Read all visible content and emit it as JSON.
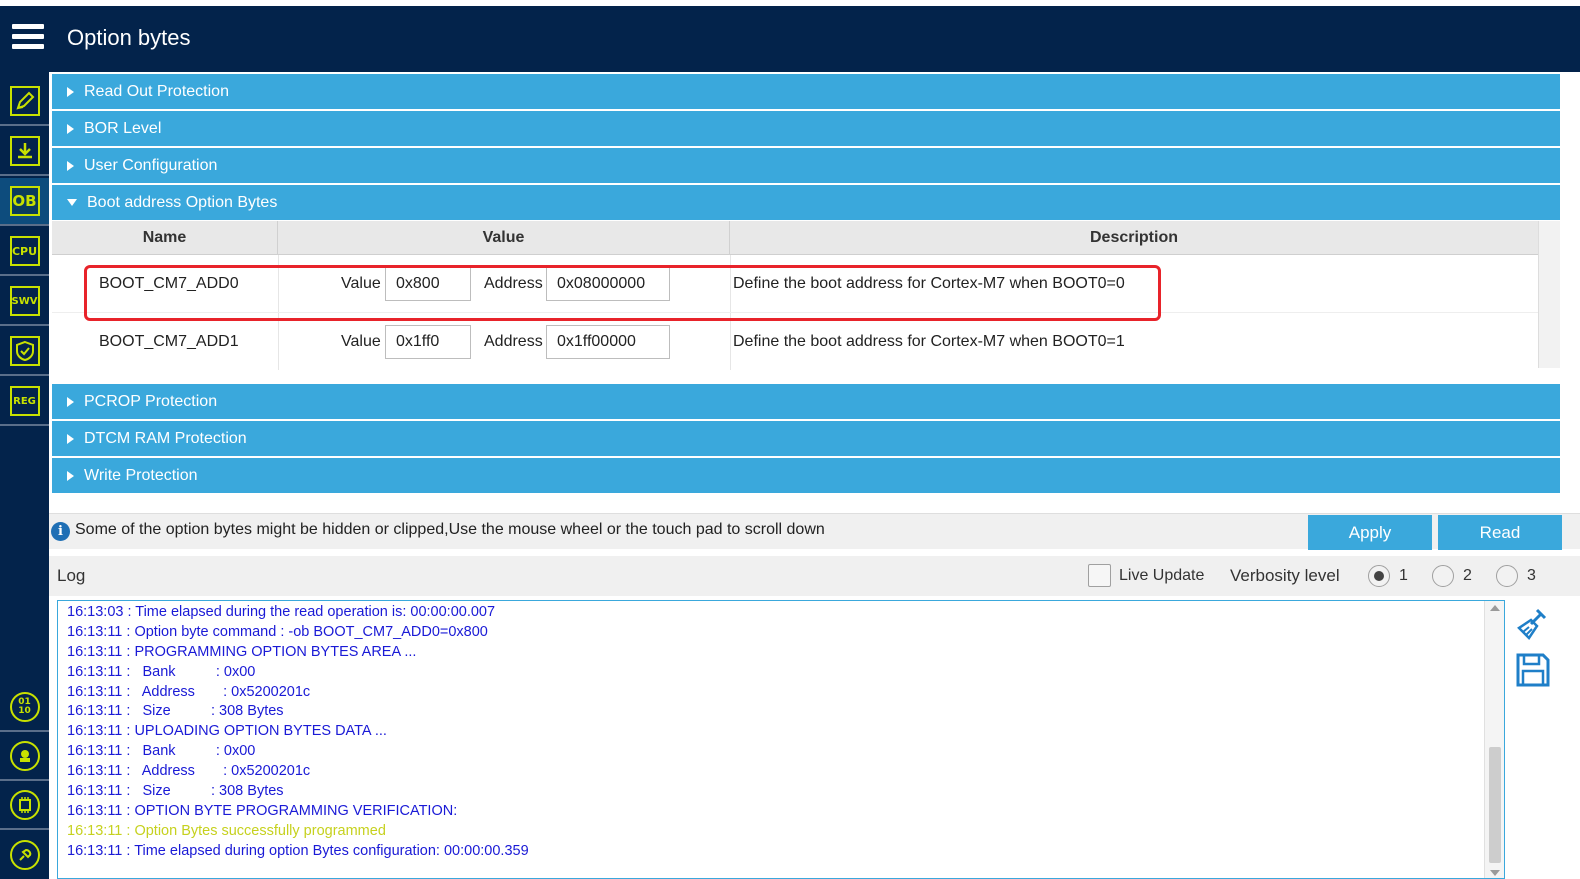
{
  "window": {
    "title": "Option bytes"
  },
  "sidebar": {
    "items": [
      {
        "label": "",
        "icon": "edit-icon"
      },
      {
        "label": "",
        "icon": "download-icon"
      },
      {
        "label": "OB",
        "icon": "option-bytes-icon",
        "active": true
      },
      {
        "label": "CPU",
        "icon": "cpu-icon"
      },
      {
        "label": "SWV",
        "icon": "swv-icon"
      },
      {
        "label": "",
        "icon": "security-shield-icon"
      },
      {
        "label": "REG",
        "icon": "registers-icon"
      },
      {
        "label": "01\n10",
        "icon": "binary-icon"
      },
      {
        "label": "",
        "icon": "beta-icon"
      },
      {
        "label": "",
        "icon": "chip-icon"
      },
      {
        "label": "",
        "icon": "plugin-icon"
      }
    ]
  },
  "sections": {
    "read_out_protection": "Read Out Protection",
    "bor_level": "BOR Level",
    "user_configuration": "User Configuration",
    "boot_address": "Boot address Option Bytes",
    "pcrop_protection": "PCROP Protection",
    "dtcm_ram_protection": "DTCM RAM Protection",
    "write_protection": "Write Protection"
  },
  "table": {
    "columns": {
      "name": "Name",
      "value": "Value",
      "description": "Description"
    },
    "value_label": "Value",
    "address_label": "Address",
    "rows": [
      {
        "name": "BOOT_CM7_ADD0",
        "value": "0x800",
        "address": "0x08000000",
        "description": "Define the boot address for Cortex-M7 when BOOT0=0"
      },
      {
        "name": "BOOT_CM7_ADD1",
        "value": "0x1ff0",
        "address": "0x1ff00000",
        "description": "Define the boot address for Cortex-M7 when BOOT0=1"
      }
    ]
  },
  "info": {
    "message": "Some of the option bytes might be hidden or clipped,Use the mouse wheel or the touch pad to scroll down",
    "apply_label": "Apply",
    "read_label": "Read"
  },
  "log": {
    "title": "Log",
    "live_update_label": "Live Update",
    "live_update_checked": false,
    "verbosity_label": "Verbosity level",
    "verbosity_options": [
      "1",
      "2",
      "3"
    ],
    "verbosity_selected": "1",
    "lines": [
      {
        "text": "16:13:03 : Time elapsed during the read operation is: 00:00:00.007",
        "status": "info"
      },
      {
        "text": "16:13:11 : Option byte command : -ob BOOT_CM7_ADD0=0x800",
        "status": "info"
      },
      {
        "text": "16:13:11 : PROGRAMMING OPTION BYTES AREA ...",
        "status": "info"
      },
      {
        "text": "16:13:11 :   Bank          : 0x00",
        "status": "info"
      },
      {
        "text": "16:13:11 :   Address       : 0x5200201c",
        "status": "info"
      },
      {
        "text": "16:13:11 :   Size          : 308 Bytes",
        "status": "info"
      },
      {
        "text": "16:13:11 : UPLOADING OPTION BYTES DATA ...",
        "status": "info"
      },
      {
        "text": "16:13:11 :   Bank          : 0x00",
        "status": "info"
      },
      {
        "text": "16:13:11 :   Address       : 0x5200201c",
        "status": "info"
      },
      {
        "text": "16:13:11 :   Size          : 308 Bytes",
        "status": "info"
      },
      {
        "text": "16:13:11 : OPTION BYTE PROGRAMMING VERIFICATION:",
        "status": "info"
      },
      {
        "text": "16:13:11 : Option Bytes successfully programmed",
        "status": "success"
      },
      {
        "text": "16:13:11 : Time elapsed during option Bytes configuration: 00:00:00.359",
        "status": "info"
      }
    ],
    "tools": [
      "clear-log-icon",
      "save-log-icon"
    ]
  },
  "colors": {
    "header_bg": "#03234b",
    "section_bg": "#3aa8dc",
    "accent_icon": "#c8e100",
    "highlight": "#e8232a",
    "log_text": "#1a1ad6",
    "log_success": "#c6d11e"
  }
}
